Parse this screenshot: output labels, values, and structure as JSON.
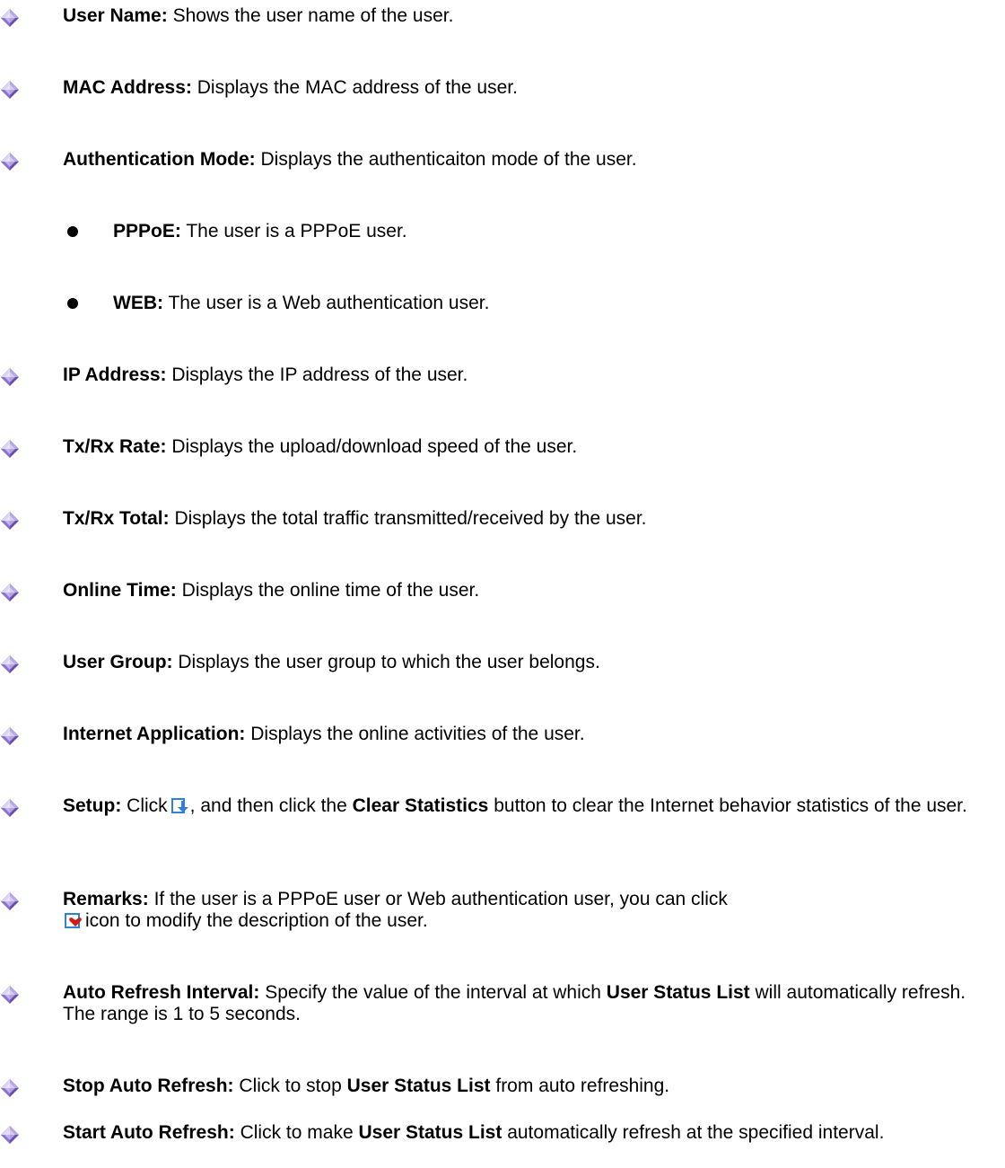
{
  "items": [
    {
      "term": "User Name:",
      "desc": "Shows the user name of the user."
    },
    {
      "term": "MAC Address:",
      "desc": "Displays the MAC address of the user."
    },
    {
      "term": "Authentication Mode:",
      "desc": "Displays the authenticaiton mode of the user."
    },
    {
      "term": "PPPoE:",
      "desc": "The user is a PPPoE user."
    },
    {
      "term": "WEB:",
      "desc": "The user is a Web authentication user."
    },
    {
      "term": "IP Address:",
      "desc": "Displays the IP address of the user."
    },
    {
      "term": "Tx/Rx Rate:",
      "desc": "Displays the upload/download speed of the user."
    },
    {
      "term": "Tx/Rx Total:",
      "desc": "Displays the total traffic transmitted/received by the user."
    },
    {
      "term": "Online Time:",
      "desc": "Displays the online time of the user."
    },
    {
      "term": "User Group:",
      "desc": "Displays the user group to which the user belongs."
    },
    {
      "term": "Internet Application:",
      "desc": "Displays the online activities of the user."
    },
    {
      "term": "Setup:",
      "p1": "Click",
      "p2": ", and then click the",
      "b1": "Clear Statistics",
      "p3": "button to clear the Internet behavior statistics of the user."
    },
    {
      "term": "Remarks:",
      "p1": "If the user is a PPPoE user or Web authentication user, you can click",
      "p2": "icon to modify the description of the user."
    },
    {
      "term": "Auto Refresh Interval:",
      "p1": "Specify the value of the interval at which",
      "b1": "User Status List",
      "p2": "will automatically refresh. The range is 1 to 5 seconds."
    },
    {
      "term": "Stop Auto Refresh:",
      "p1": "Click to stop",
      "b1": "User Status List",
      "p2": "from auto refreshing."
    },
    {
      "term": "Start Auto Refresh:",
      "p1": "Click to make",
      "b1": "User Status List",
      "p2": "automatically refresh at the specified interval."
    }
  ],
  "colors": {
    "diamond_dark": "#6a4fb0",
    "diamond_light": "#c6b8ec",
    "icon_blue": "#2f80d9",
    "icon_heart": "#d01a1a"
  }
}
